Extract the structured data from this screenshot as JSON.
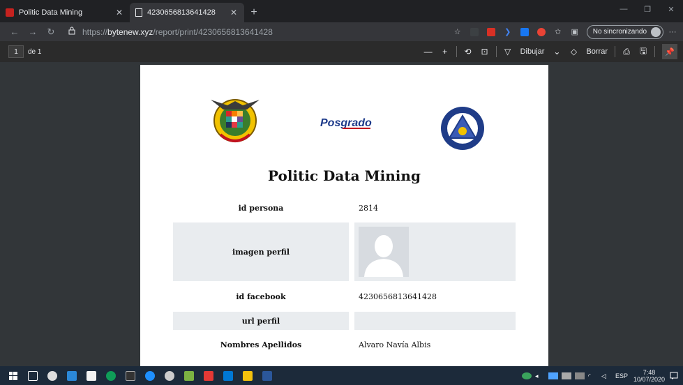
{
  "browser": {
    "tabs": [
      {
        "title": "Politic Data Mining",
        "active": false
      },
      {
        "title": "4230656813641428",
        "active": true
      }
    ],
    "new_tab_symbol": "+",
    "url_scheme": "https://",
    "url_host": "bytenew.xyz",
    "url_path": "/report/print/4230656813641428",
    "sync_label": "No sincronizando",
    "more_symbol": "···"
  },
  "pdf_toolbar": {
    "page_number": "1",
    "page_of": "de 1",
    "draw_label": "Dibujar",
    "erase_label": "Borrar"
  },
  "report": {
    "title": "Politic Data Mining",
    "logo_mid_text": "Posgrado",
    "rows": [
      {
        "label": "id persona",
        "value": "2814"
      },
      {
        "label": "imagen perfil",
        "value": ""
      },
      {
        "label": "id facebook",
        "value": "4230656813641428"
      },
      {
        "label": "url perfil",
        "value": ""
      },
      {
        "label": "Nombres Apellidos",
        "value": "Alvaro Navía Albis"
      }
    ]
  },
  "taskbar": {
    "language": "ESP",
    "time": "7:48",
    "date": "10/07/2020"
  },
  "colors": {
    "browser_dark": "#202124",
    "toolbar": "#35363a",
    "pdf_bg": "#323639",
    "row_shade": "#e9ecef",
    "taskbar": "#1c2a3a"
  }
}
